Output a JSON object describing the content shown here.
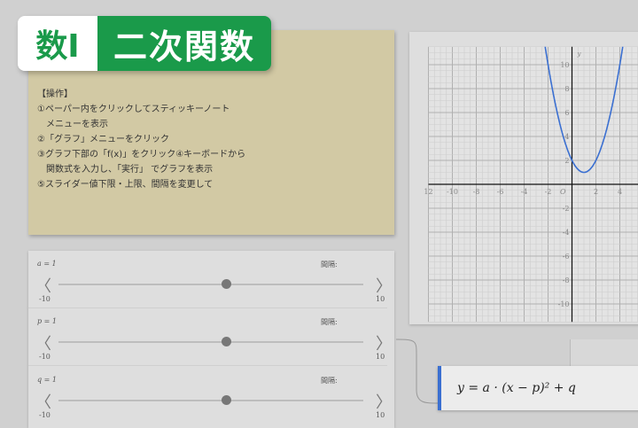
{
  "badge": {
    "subject": "数Ⅰ",
    "topic": "二次関数",
    "colors": {
      "green": "#1a9a4a",
      "white": "#ffffff"
    }
  },
  "sticky": {
    "color": "#d2c9a4",
    "lines": [
      "【操作】",
      "①ペーパー内をクリックしてスティッキーノート",
      "　メニューを表示",
      "②「グラフ」メニューをクリック",
      "③グラフ下部の「f(x)」をクリック④キーボードから",
      "　関数式を入力し、「実行」 でグラフを表示",
      "⑤スライダー値下限・上限、間隔を変更して"
    ]
  },
  "chart_data": {
    "type": "line",
    "function": "y = (x-1)^2 + 1",
    "xlim": [
      -12,
      5.5
    ],
    "ylim": [
      -11.5,
      11.5
    ],
    "x_ticks": [
      -12,
      -10,
      -8,
      -6,
      -4,
      -2,
      2,
      4
    ],
    "x_tick_labels": [
      "12",
      "-10",
      "-8",
      "-6",
      "-4",
      "-2",
      "2",
      "4"
    ],
    "y_ticks": [
      10,
      8,
      6,
      4,
      2,
      -2,
      -4,
      -6,
      -8,
      -10
    ],
    "origin_label": "O",
    "ylabel": "y",
    "grid": true,
    "curve_color": "#3a6fd1"
  },
  "sliders": [
    {
      "label": "a = 1",
      "value": 1,
      "min": "-10",
      "max": "10",
      "step_label": "間隔:"
    },
    {
      "label": "p = 1",
      "value": 1,
      "min": "-10",
      "max": "10",
      "step_label": "間隔:"
    },
    {
      "label": "q = 1",
      "value": 1,
      "min": "-10",
      "max": "10",
      "step_label": "間隔:"
    }
  ],
  "formula": {
    "text": "y = a · (x − p)² + q",
    "accent": "#3a6fd1"
  }
}
